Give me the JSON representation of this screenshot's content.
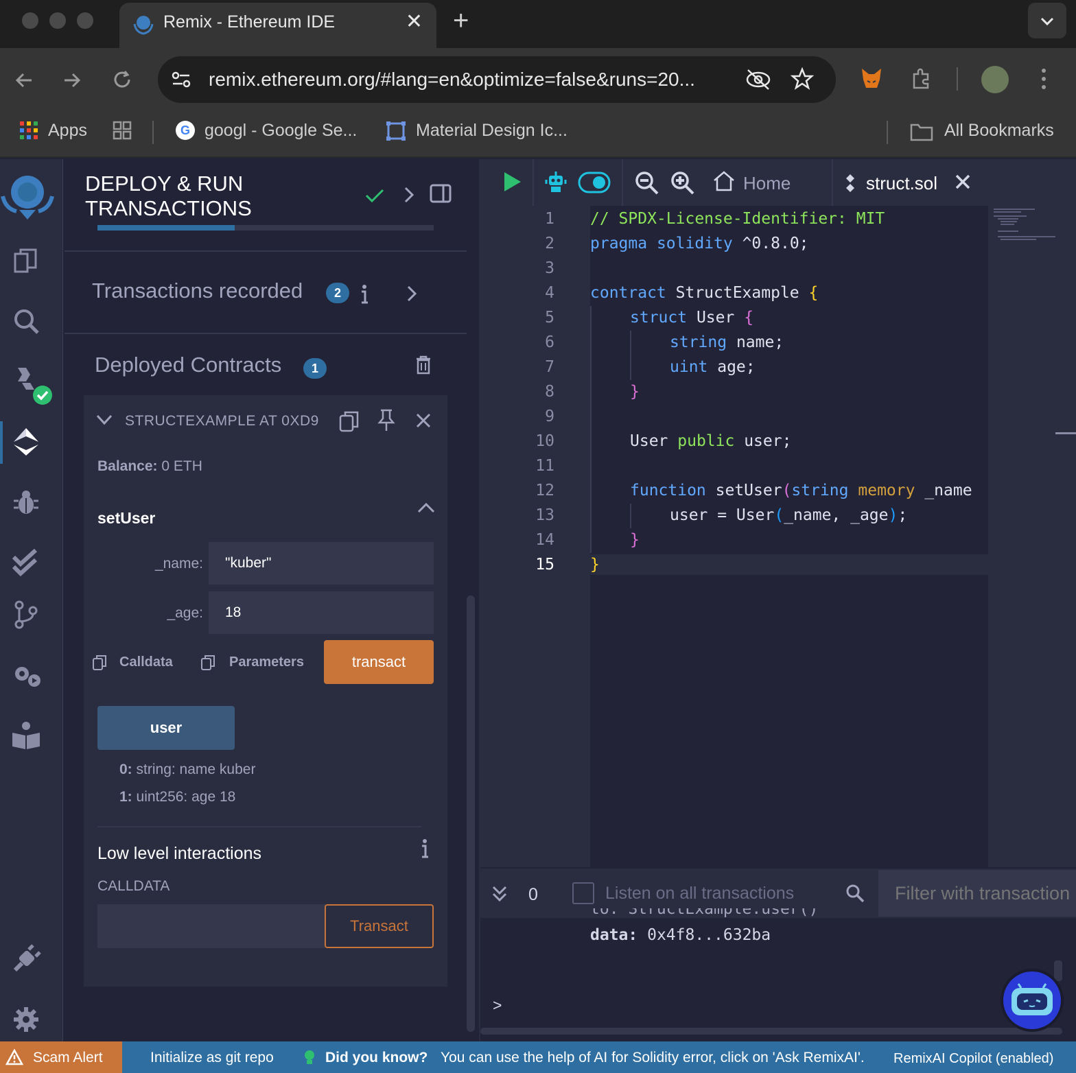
{
  "browser": {
    "tab_title": "Remix - Ethereum IDE",
    "close_glyph": "✕",
    "new_tab_glyph": "+",
    "tab_menu_glyph": "⌄",
    "url": "remix.ethereum.org/#lang=en&optimize=false&runs=20...",
    "bookmarks": {
      "apps": "Apps",
      "google": "googl - Google Se...",
      "material": "Material Design Ic...",
      "all": "All Bookmarks"
    }
  },
  "panel": {
    "title": "DEPLOY & RUN\nTRANSACTIONS",
    "transactions_recorded": "Transactions recorded",
    "transactions_count": "2",
    "deployed_contracts": "Deployed Contracts",
    "deployed_count": "1",
    "contract_name": "STRUCTEXAMPLE AT 0XD9",
    "balance_label": "Balance:",
    "balance_value": "0 ETH",
    "function_name": "setUser",
    "param_name_label": "_name:",
    "param_name_value": "\"kuber\"",
    "param_age_label": "_age:",
    "param_age_value": "18",
    "calldata_label": "Calldata",
    "parameters_label": "Parameters",
    "transact_label": "transact",
    "user_button": "user",
    "output_0_key": "0:",
    "output_0_value": "string: name kuber",
    "output_1_key": "1:",
    "output_1_value": "uint256: age 18",
    "low_level_title": "Low level interactions",
    "calldata_caps": "CALLDATA",
    "transact_button": "Transact"
  },
  "editor": {
    "home_tab": "Home",
    "file_tab": "struct.sol",
    "line_numbers": [
      "1",
      "2",
      "3",
      "4",
      "5",
      "6",
      "7",
      "8",
      "9",
      "10",
      "11",
      "12",
      "13",
      "14",
      "15"
    ],
    "code": {
      "l1": "// SPDX-License-Identifier: MIT",
      "l2_kw": "pragma",
      "l2_kw2": "solidity",
      "l2_rest": " ^0.8.0;",
      "l4_kw": "contract",
      "l4_name": " StructExample ",
      "l5_kw": "struct",
      "l5_name": " User ",
      "l6_kw": "string",
      "l6_rest": " name;",
      "l7_kw": "uint",
      "l7_rest": " age;",
      "l10_type": "User ",
      "l10_kw": "public",
      "l10_rest": " user;",
      "l12_kw": "function",
      "l12_name": " setUser",
      "l12_type": "string",
      "l12_mem": "memory",
      "l12_rest": " _name",
      "l13_a": "user = User",
      "l13_b": "_name, _age",
      "l13_c": ";",
      "open_brace": "{",
      "close_brace": "}",
      "open_paren": "(",
      "close_paren": ")"
    }
  },
  "terminal": {
    "count": "0",
    "listen_label": "Listen on all transactions",
    "filter_placeholder": "Filter with transaction",
    "partial_line": "to: StructExample.user()",
    "data_key": "data:",
    "data_value": " 0x4f8...632ba",
    "prompt": ">"
  },
  "statusbar": {
    "scam_alert": "Scam Alert",
    "git": "Initialize as git repo",
    "did_you_know": "Did you know?",
    "tip": "You can use the help of AI for Solidity error, click on 'Ask RemixAI'.",
    "copilot": "RemixAI Copilot (enabled)"
  },
  "colors": {
    "accent_green": "#2fbf71",
    "transact_orange": "#c97539",
    "badge_blue": "#2f6ea0",
    "status_bar": "#2f6ea0"
  }
}
